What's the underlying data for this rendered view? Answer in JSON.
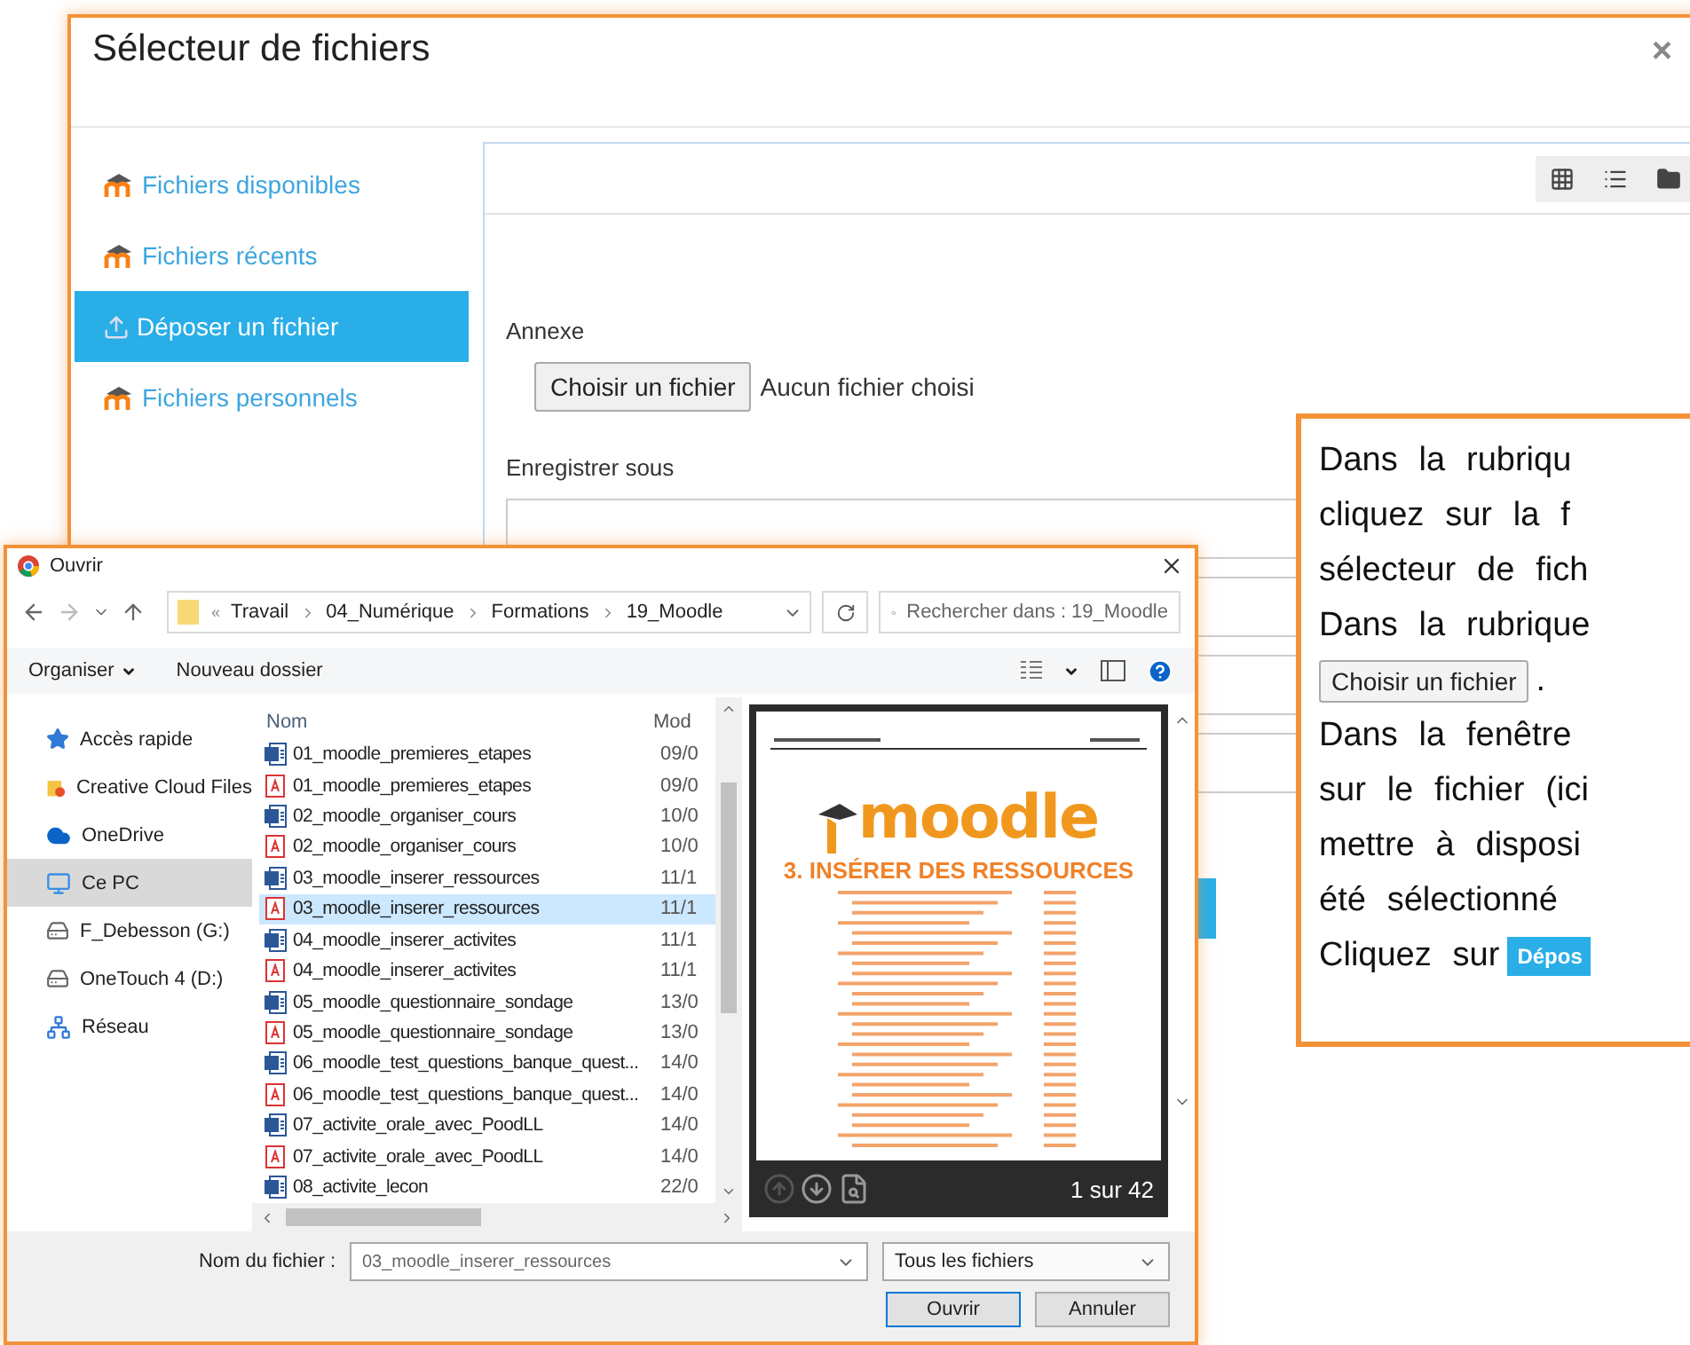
{
  "file_picker": {
    "title": "Sélecteur de fichiers",
    "close": "×",
    "sidebar": [
      {
        "label": "Fichiers disponibles",
        "kind": "repository",
        "selected": false
      },
      {
        "label": "Fichiers récents",
        "kind": "repository",
        "selected": false
      },
      {
        "label": "Déposer un fichier",
        "kind": "upload",
        "selected": true
      },
      {
        "label": "Fichiers personnels",
        "kind": "repository",
        "selected": false
      }
    ],
    "form": {
      "attachment_label": "Annexe",
      "choose_button": "Choisir un fichier",
      "no_file": "Aucun fichier choisi",
      "save_as_label": "Enregistrer sous"
    }
  },
  "open_dialog": {
    "title": "Ouvrir",
    "overflow": "«",
    "breadcrumb": [
      "Travail",
      "04_Numérique",
      "Formations",
      "19_Moodle"
    ],
    "search": {
      "placeholder": "Rechercher dans : 19_Moodle"
    },
    "toolbar": {
      "organize": "Organiser",
      "new_folder": "Nouveau dossier"
    },
    "nav": [
      {
        "label": "Accès rapide",
        "kind": "quick",
        "selected": false
      },
      {
        "label": "Creative Cloud Files",
        "kind": "cloudfiles",
        "selected": false
      },
      {
        "label": "OneDrive",
        "kind": "onedrive",
        "selected": false
      },
      {
        "label": "Ce PC",
        "kind": "pc",
        "selected": true
      },
      {
        "label": "F_Debesson (G:)",
        "kind": "drive",
        "selected": false
      },
      {
        "label": "OneTouch 4 (D:)",
        "kind": "drive",
        "selected": false
      },
      {
        "label": "Réseau",
        "kind": "network",
        "selected": false
      }
    ],
    "columns": [
      "Nom",
      "Mod"
    ],
    "files": [
      {
        "name": "01_moodle_premieres_etapes",
        "kind": "word",
        "date": "09/0",
        "selected": false
      },
      {
        "name": "01_moodle_premieres_etapes",
        "kind": "pdf",
        "date": "09/0",
        "selected": false
      },
      {
        "name": "02_moodle_organiser_cours",
        "kind": "word",
        "date": "10/0",
        "selected": false
      },
      {
        "name": "02_moodle_organiser_cours",
        "kind": "pdf",
        "date": "10/0",
        "selected": false
      },
      {
        "name": "03_moodle_inserer_ressources",
        "kind": "word",
        "date": "11/1",
        "selected": false
      },
      {
        "name": "03_moodle_inserer_ressources",
        "kind": "pdf",
        "date": "11/1",
        "selected": true
      },
      {
        "name": "04_moodle_inserer_activites",
        "kind": "word",
        "date": "11/1",
        "selected": false
      },
      {
        "name": "04_moodle_inserer_activites",
        "kind": "pdf",
        "date": "11/1",
        "selected": false
      },
      {
        "name": "05_moodle_questionnaire_sondage",
        "kind": "word",
        "date": "13/0",
        "selected": false
      },
      {
        "name": "05_moodle_questionnaire_sondage",
        "kind": "pdf",
        "date": "13/0",
        "selected": false
      },
      {
        "name": "06_moodle_test_questions_banque_quest...",
        "kind": "word",
        "date": "14/0",
        "selected": false
      },
      {
        "name": "06_moodle_test_questions_banque_quest...",
        "kind": "pdf",
        "date": "14/0",
        "selected": false
      },
      {
        "name": "07_activite_orale_avec_PoodLL",
        "kind": "word",
        "date": "14/0",
        "selected": false
      },
      {
        "name": "07_activite_orale_avec_PoodLL",
        "kind": "pdf",
        "date": "14/0",
        "selected": false
      },
      {
        "name": "08_activite_lecon",
        "kind": "word",
        "date": "22/0",
        "selected": false
      }
    ],
    "preview": {
      "logo": "moodle",
      "heading": "3. INSÉRER DES RESSOURCES",
      "page": "1 sur 42"
    },
    "filename": {
      "label": "Nom du fichier :",
      "value": "03_moodle_inserer_ressources"
    },
    "filter": "Tous les fichiers",
    "buttons": [
      "Ouvrir",
      "Annuler"
    ]
  },
  "callout": {
    "lines": [
      {
        "kind": "text",
        "text": "Dans la rubriqu"
      },
      {
        "kind": "text",
        "text": "cliquez sur la f"
      },
      {
        "kind": "text",
        "text": "sélecteur de fich"
      },
      {
        "kind": "text",
        "text": "Dans la rubrique"
      },
      {
        "kind": "button",
        "button": "Choisir un fichier",
        "text": "."
      },
      {
        "kind": "text",
        "text": "Dans la fenêtre"
      },
      {
        "kind": "text",
        "text": "sur le fichier (ici"
      },
      {
        "kind": "text",
        "text": "mettre à disposi"
      },
      {
        "kind": "text",
        "text": "été sélectionné"
      },
      {
        "kind": "badge",
        "text": "Cliquez sur",
        "badge": "Dépos"
      }
    ]
  }
}
